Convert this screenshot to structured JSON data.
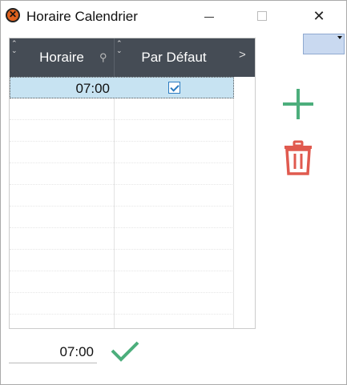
{
  "window": {
    "title": "Horaire Calendrier",
    "controls": {
      "minimize_icon": "minimize-icon",
      "maximize_icon": "maximize-icon",
      "close_icon": "close-icon"
    }
  },
  "dropdown": {
    "icon": "dropdown-arrow-icon",
    "color": "#c9d9f0"
  },
  "grid": {
    "header_bg": "#454c55",
    "columns": [
      "Horaire",
      "Par Défaut"
    ],
    "rows": [
      {
        "time": "07:00",
        "default": true,
        "selected": true
      }
    ]
  },
  "actions": {
    "add_icon": "plus-icon",
    "add_color": "#4cae7c",
    "delete_icon": "trash-icon",
    "delete_color": "#e05a4f"
  },
  "footer": {
    "time_value": "07:00",
    "confirm_icon": "checkmark-icon",
    "confirm_color": "#4cae7c"
  }
}
